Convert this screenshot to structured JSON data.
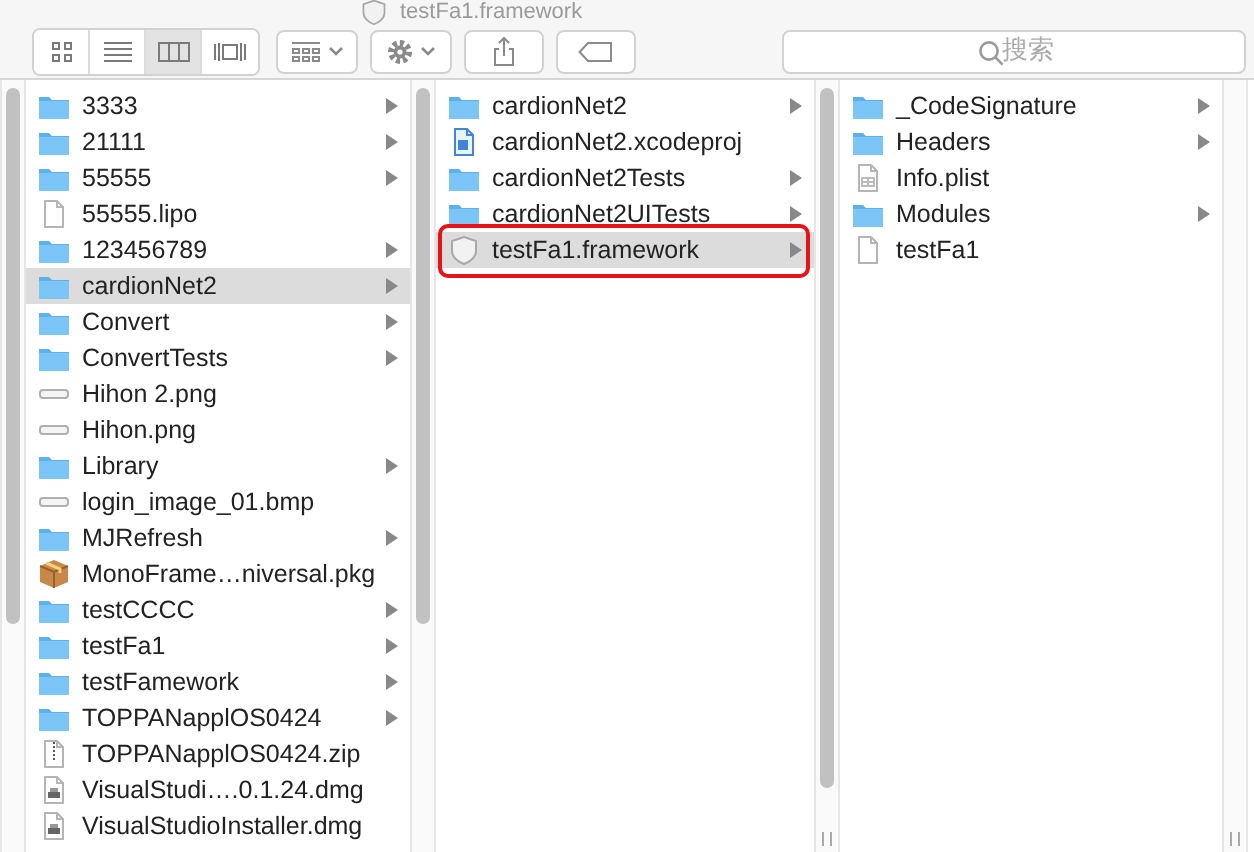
{
  "window": {
    "title": "testFa1.framework"
  },
  "toolbar": {
    "view_modes": [
      {
        "kind": "icons",
        "selected": false
      },
      {
        "kind": "list",
        "selected": false
      },
      {
        "kind": "columns",
        "selected": true
      },
      {
        "kind": "coverflow",
        "selected": false
      }
    ],
    "search": {
      "placeholder": "搜索"
    }
  },
  "columns": [
    {
      "items": [
        {
          "name": "3333",
          "kind": "folder",
          "expandable": true,
          "selected": false,
          "outlined": false
        },
        {
          "name": "21111",
          "kind": "folder",
          "expandable": true,
          "selected": false,
          "outlined": false
        },
        {
          "name": "55555",
          "kind": "folder",
          "expandable": true,
          "selected": false,
          "outlined": false
        },
        {
          "name": "55555.lipo",
          "kind": "file",
          "expandable": false,
          "selected": false,
          "outlined": false
        },
        {
          "name": "123456789",
          "kind": "folder",
          "expandable": true,
          "selected": false,
          "outlined": false
        },
        {
          "name": "cardionNet2",
          "kind": "folder",
          "expandable": true,
          "selected": true,
          "outlined": false
        },
        {
          "name": "Convert",
          "kind": "folder",
          "expandable": true,
          "selected": false,
          "outlined": false
        },
        {
          "name": "ConvertTests",
          "kind": "folder",
          "expandable": true,
          "selected": false,
          "outlined": false
        },
        {
          "name": "Hihon 2.png",
          "kind": "image",
          "expandable": false,
          "selected": false,
          "outlined": false
        },
        {
          "name": "Hihon.png",
          "kind": "image",
          "expandable": false,
          "selected": false,
          "outlined": false
        },
        {
          "name": "Library",
          "kind": "folder",
          "expandable": true,
          "selected": false,
          "outlined": false
        },
        {
          "name": "login_image_01.bmp",
          "kind": "image",
          "expandable": false,
          "selected": false,
          "outlined": false
        },
        {
          "name": "MJRefresh",
          "kind": "folder",
          "expandable": true,
          "selected": false,
          "outlined": false
        },
        {
          "name": "MonoFrame…niversal.pkg",
          "kind": "package",
          "expandable": false,
          "selected": false,
          "outlined": false
        },
        {
          "name": "testCCCC",
          "kind": "folder",
          "expandable": true,
          "selected": false,
          "outlined": false
        },
        {
          "name": "testFa1",
          "kind": "folder",
          "expandable": true,
          "selected": false,
          "outlined": false
        },
        {
          "name": "testFamework",
          "kind": "folder",
          "expandable": true,
          "selected": false,
          "outlined": false
        },
        {
          "name": "TOPPANapplOS0424",
          "kind": "folder",
          "expandable": true,
          "selected": false,
          "outlined": false
        },
        {
          "name": "TOPPANapplOS0424.zip",
          "kind": "zip",
          "expandable": false,
          "selected": false,
          "outlined": false
        },
        {
          "name": "VisualStudi….0.1.24.dmg",
          "kind": "disk",
          "expandable": false,
          "selected": false,
          "outlined": false
        },
        {
          "name": "VisualStudioInstaller.dmg",
          "kind": "disk",
          "expandable": false,
          "selected": false,
          "outlined": false
        }
      ]
    },
    {
      "items": [
        {
          "name": "cardionNet2",
          "kind": "folder",
          "expandable": true,
          "selected": false,
          "outlined": false
        },
        {
          "name": "cardionNet2.xcodeproj",
          "kind": "project",
          "expandable": false,
          "selected": false,
          "outlined": false
        },
        {
          "name": "cardionNet2Tests",
          "kind": "folder",
          "expandable": true,
          "selected": false,
          "outlined": false
        },
        {
          "name": "cardionNet2UITests",
          "kind": "folder",
          "expandable": true,
          "selected": false,
          "outlined": false
        },
        {
          "name": "testFa1.framework",
          "kind": "framework",
          "expandable": true,
          "selected": true,
          "outlined": true
        }
      ]
    },
    {
      "items": [
        {
          "name": "_CodeSignature",
          "kind": "folder",
          "expandable": true,
          "selected": false,
          "outlined": false
        },
        {
          "name": "Headers",
          "kind": "folder",
          "expandable": true,
          "selected": false,
          "outlined": false
        },
        {
          "name": "Info.plist",
          "kind": "plist",
          "expandable": false,
          "selected": false,
          "outlined": false
        },
        {
          "name": "Modules",
          "kind": "folder",
          "expandable": true,
          "selected": false,
          "outlined": false
        },
        {
          "name": "testFa1",
          "kind": "file",
          "expandable": false,
          "selected": false,
          "outlined": false
        }
      ]
    }
  ]
}
